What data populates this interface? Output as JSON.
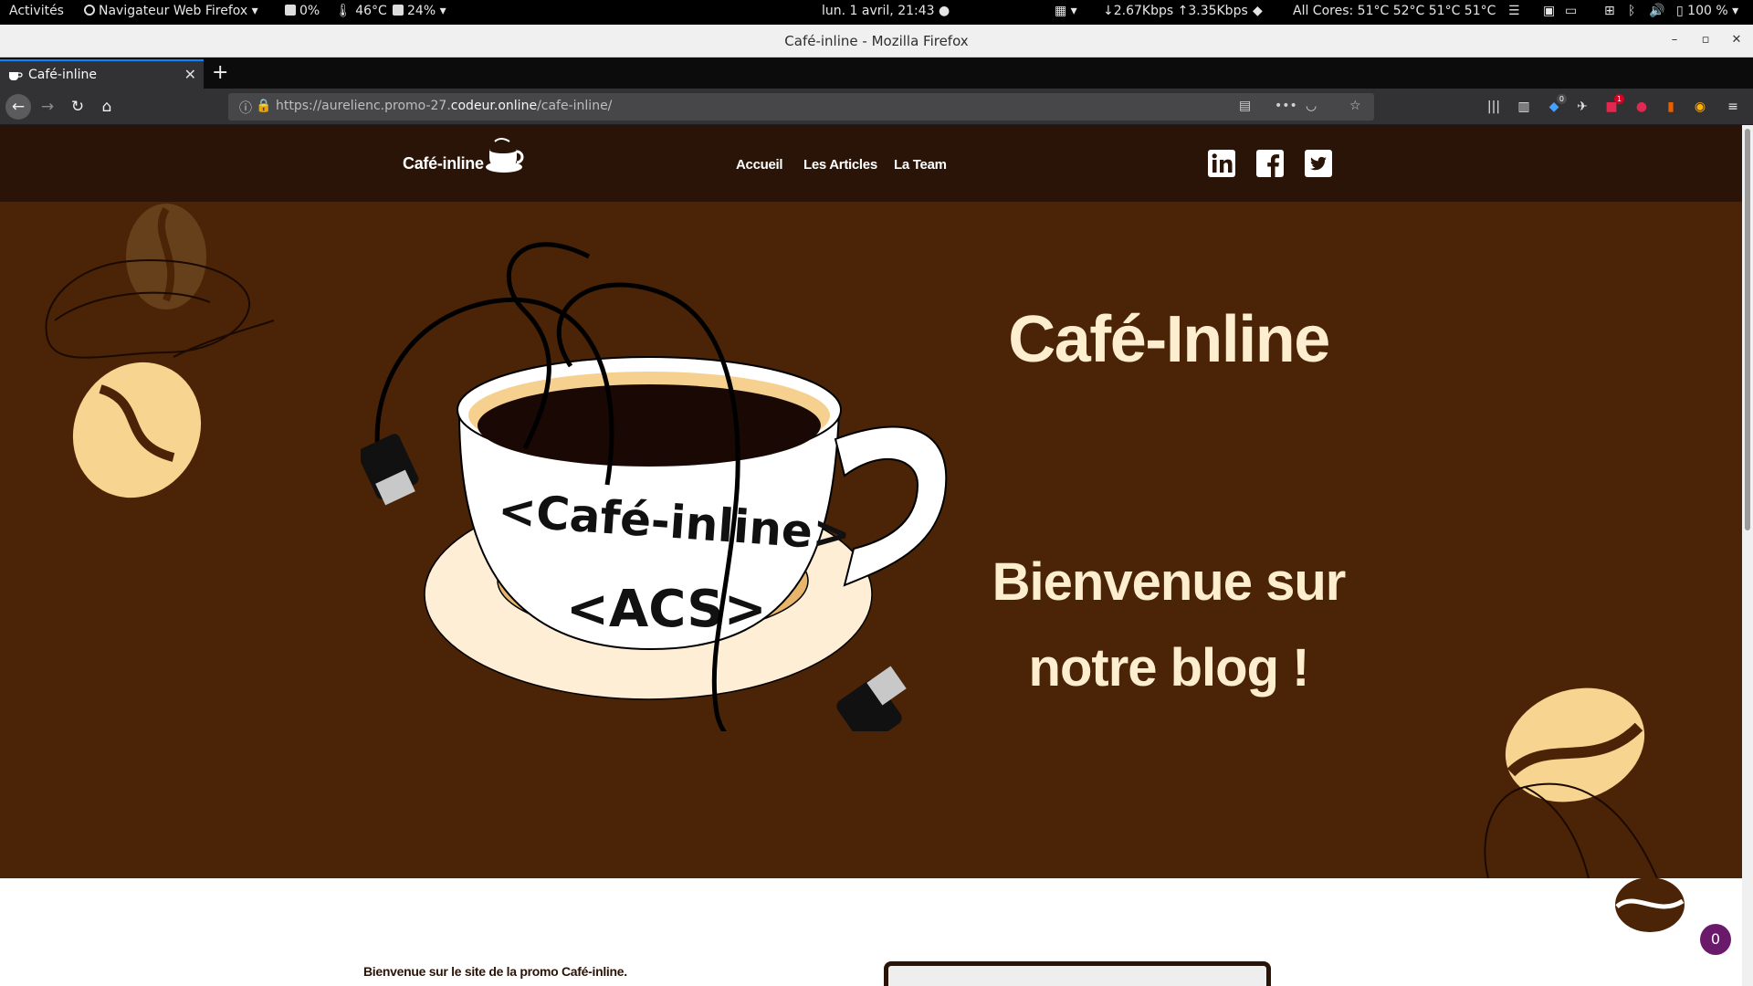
{
  "gnome": {
    "activities": "Activités",
    "app_menu": "Navigateur Web Firefox",
    "cpu": "0%",
    "temp": "46°C",
    "mem": "24%",
    "clock": "lun.  1 avril, 21:43",
    "net": "↓2.67Kbps ↑3.35Kbps",
    "cores": "All Cores: 51°C 52°C 51°C 51°C",
    "battery": "100 %"
  },
  "window": {
    "title": "Café-inline - Mozilla Firefox"
  },
  "tabs": [
    {
      "label": "Café-inline"
    }
  ],
  "toolbar": {
    "url_prefix": "https://aurelienc.promo-27.",
    "url_domain": "codeur.online",
    "url_path": "/cafe-inline/",
    "badge_counts": [
      "0",
      "1"
    ]
  },
  "site": {
    "logo_text": "Café-inline",
    "nav": [
      "Accueil",
      "Les Articles",
      "La Team"
    ],
    "social": [
      "linkedin-icon",
      "facebook-icon",
      "twitter-icon"
    ],
    "hero_title": "Café-Inline",
    "hero_subtitle_line1": "Bienvenue sur",
    "hero_subtitle_line2": "notre blog !",
    "cup_text_1": "<Café-inline>",
    "cup_text_2": "<ACS>",
    "intro_text": "Bienvenue sur le site de la promo Café-inline.",
    "counter": "0"
  },
  "colors": {
    "header_bg": "#2a1407",
    "hero_bg": "#4b2306",
    "cream": "#fdeecf",
    "bean_light": "#f7d48f",
    "bean_dark": "#6b4420"
  }
}
